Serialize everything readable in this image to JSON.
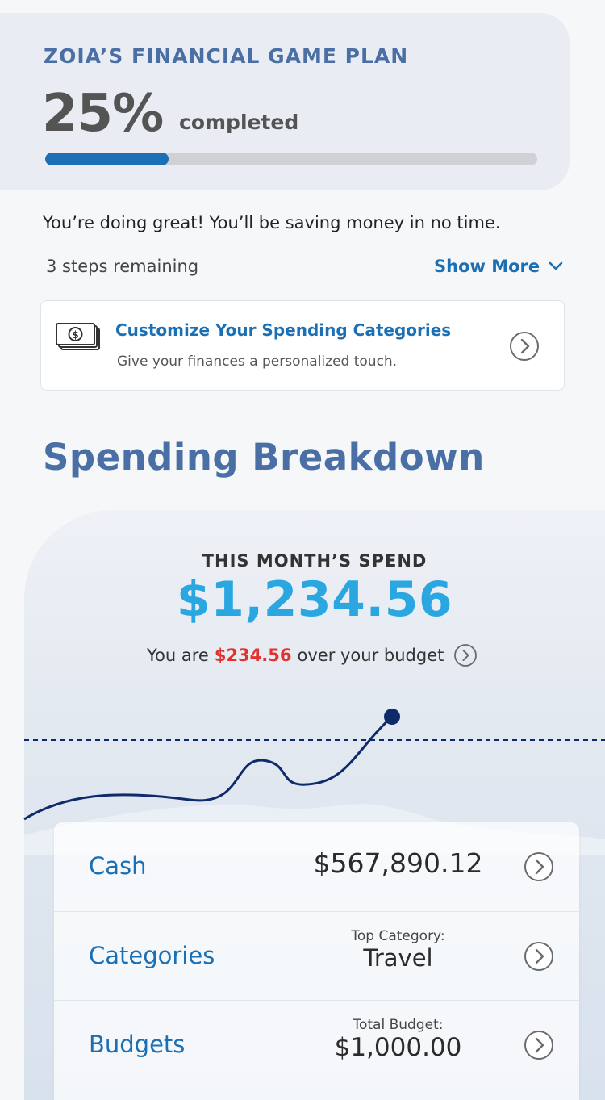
{
  "game_plan": {
    "title": "ZOIA’S FINANCIAL GAME PLAN",
    "percent_label": "25%",
    "completed_label": "completed",
    "progress_fraction": 0.25,
    "encouragement": "You’re doing great! You’ll be saving money in no time.",
    "steps_remaining": "3 steps remaining",
    "show_more_label": "Show More",
    "task": {
      "icon": "money-stack-icon",
      "title": "Customize Your Spending Categories",
      "subtitle": "Give your finances a personalized touch."
    }
  },
  "spending": {
    "section_title": "Spending Breakdown",
    "month_label": "THIS MONTH’S SPEND",
    "month_amount": "$1,234.56",
    "budget_prefix": "You are",
    "over_amount": "$234.56",
    "budget_suffix": "over your budget",
    "rows": [
      {
        "label": "Cash",
        "caption": "",
        "value": "$567,890.12"
      },
      {
        "label": "Categories",
        "caption": "Top Category:",
        "value": "Travel"
      },
      {
        "label": "Budgets",
        "caption": "Total Budget:",
        "value": "$1,000.00"
      }
    ]
  },
  "colors": {
    "brand_blue": "#1a6fb5",
    "heading_blue": "#4a6fa5",
    "amount_blue": "#2aa7e0",
    "over_red": "#e0322f",
    "trend_navy": "#0f2a6b"
  }
}
